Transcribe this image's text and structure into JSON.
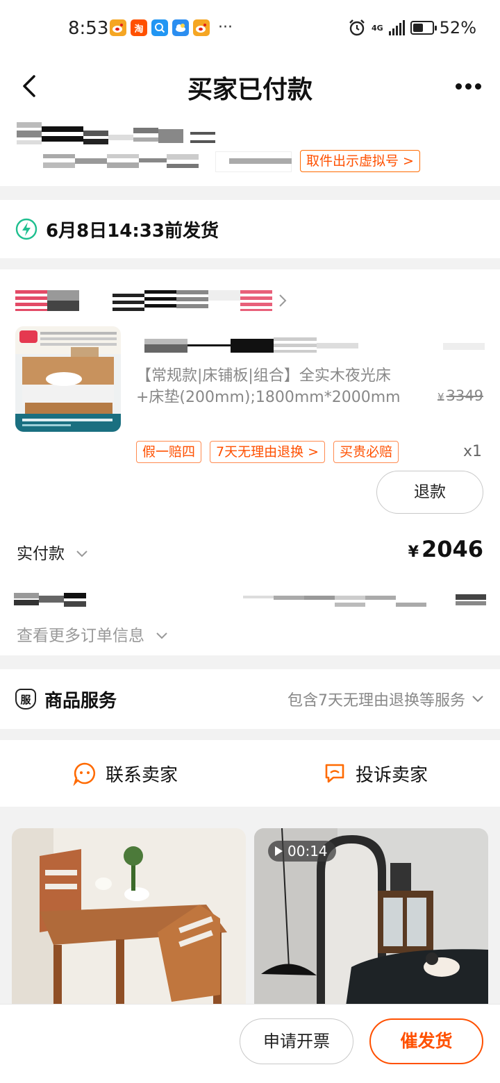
{
  "status_bar": {
    "time": "8:53",
    "apps": [
      {
        "icon": "weibo-icon",
        "color": "#f5a623"
      },
      {
        "icon": "taobao-icon",
        "color": "#ff5000",
        "label": "淘"
      },
      {
        "icon": "search-app-icon",
        "color": "#2196f3"
      },
      {
        "icon": "weather-icon",
        "color": "#2b8ef0"
      },
      {
        "icon": "weibo-icon",
        "color": "#f5a623"
      }
    ],
    "more": "···",
    "network": "4G",
    "battery": "52%",
    "battery_level": 0.52
  },
  "header": {
    "title": "买家已付款",
    "back_icon": "chevron-left-icon",
    "more_icon": "more-dots-icon"
  },
  "address": {
    "virtual_number_button": "取件出示虚拟号 >"
  },
  "shipping": {
    "text": "6月8日14:33前发货",
    "icon": "lightning-icon",
    "icon_color": "#1fbf8f"
  },
  "order": {
    "product_description": "【常规款|床铺板|组合】全实木夜光床+床垫(200mm);1800mm*2000mm",
    "original_price_symbol": "¥",
    "original_price": "3349",
    "tags": [
      "假一赔四",
      "7天无理由退换 >",
      "买贵必赔"
    ],
    "quantity": "x1",
    "refund_button": "退款",
    "paid_label": "实付款",
    "paid_currency": "¥",
    "paid_amount": "2046",
    "more_info": "查看更多订单信息"
  },
  "service": {
    "icon_label": "服",
    "title": "商品服务",
    "detail": "包含7天无理由退换等服务"
  },
  "contact": {
    "contact_seller": "联系卖家",
    "complain_seller": "投诉卖家"
  },
  "recommend": {
    "video_duration": "00:14"
  },
  "bottom": {
    "invoice_button": "申请开票",
    "urge_button": "催发货"
  },
  "colors": {
    "accent": "#ff5000",
    "green": "#1fbf8f",
    "background": "#f2f2f2"
  }
}
